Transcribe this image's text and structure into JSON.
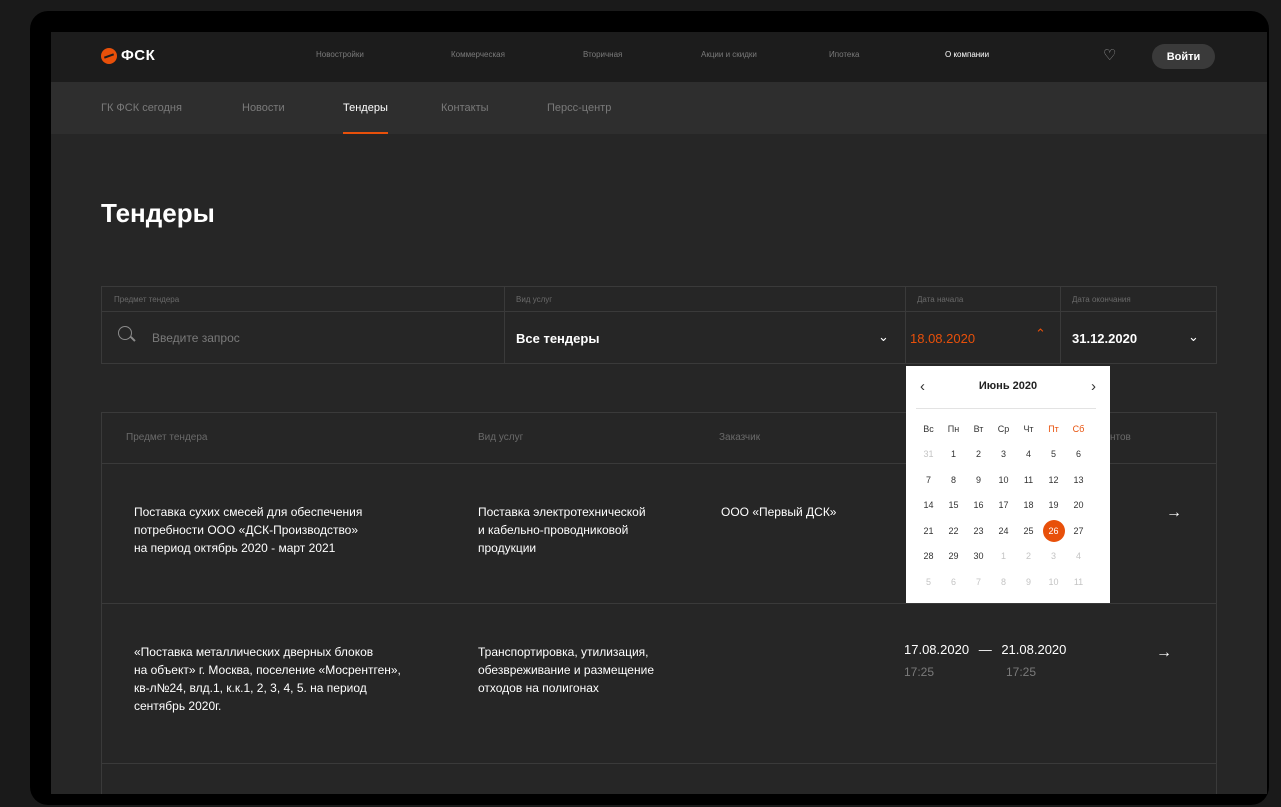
{
  "topnav": {
    "logo_text": "ФСК",
    "items": [
      "Новостройки",
      "Коммерческая",
      "Вторичная",
      "Акции и скидки",
      "Ипотека",
      "О компании"
    ],
    "active_item": "О компании",
    "login_label": "Войти"
  },
  "subnav": {
    "items": [
      "ГК ФСК сегодня",
      "Новости",
      "Тендеры",
      "Контакты",
      "Персс-центр"
    ],
    "active_item": "Тендеры"
  },
  "page_title": "Тендеры",
  "filters": {
    "subject": {
      "label": "Предмет тендера",
      "placeholder": "Введите запрос"
    },
    "service": {
      "label": "Вид услуг",
      "value": "Все тендеры"
    },
    "start": {
      "label": "Дата начала",
      "value": "18.08.2020"
    },
    "end": {
      "label": "Дата окончания",
      "value": "31.12.2020"
    }
  },
  "calendar": {
    "month": "Июнь 2020",
    "weekdays": [
      "Вс",
      "Пн",
      "Вт",
      "Ср",
      "Чт",
      "Пт",
      "Сб"
    ],
    "weekend_days": [
      "Пт",
      "Сб"
    ],
    "days": [
      {
        "d": "31",
        "m": true
      },
      {
        "d": "1"
      },
      {
        "d": "2"
      },
      {
        "d": "3"
      },
      {
        "d": "4"
      },
      {
        "d": "5"
      },
      {
        "d": "6"
      },
      {
        "d": "7"
      },
      {
        "d": "8"
      },
      {
        "d": "9"
      },
      {
        "d": "10"
      },
      {
        "d": "11"
      },
      {
        "d": "12"
      },
      {
        "d": "13"
      },
      {
        "d": "14"
      },
      {
        "d": "15"
      },
      {
        "d": "16"
      },
      {
        "d": "17"
      },
      {
        "d": "18"
      },
      {
        "d": "19"
      },
      {
        "d": "20"
      },
      {
        "d": "21"
      },
      {
        "d": "22"
      },
      {
        "d": "23"
      },
      {
        "d": "24"
      },
      {
        "d": "25"
      },
      {
        "d": "26",
        "s": true
      },
      {
        "d": "27"
      },
      {
        "d": "28"
      },
      {
        "d": "29"
      },
      {
        "d": "30"
      },
      {
        "d": "1",
        "m": true
      },
      {
        "d": "2",
        "m": true
      },
      {
        "d": "3",
        "m": true
      },
      {
        "d": "4",
        "m": true
      },
      {
        "d": "5",
        "m": true
      },
      {
        "d": "6",
        "m": true
      },
      {
        "d": "7",
        "m": true
      },
      {
        "d": "8",
        "m": true
      },
      {
        "d": "9",
        "m": true
      },
      {
        "d": "10",
        "m": true
      },
      {
        "d": "11",
        "m": true
      }
    ],
    "selected_day": "26"
  },
  "table": {
    "headers": [
      "Предмет тендера",
      "Вид услуг",
      "Заказчик",
      "нтов"
    ],
    "rows": [
      {
        "subject": [
          "Поставка сухих смесей для обеспечения",
          "потребности ООО «ДСК-Производство»",
          "на период октябрь 2020 - март 2021"
        ],
        "service": [
          "Поставка электротехнической",
          "и кабельно-проводниковой",
          "продукции"
        ],
        "customer": "ООО «Первый ДСК»",
        "date_from": "",
        "date_to": "",
        "time_from": "",
        "time_to": ""
      },
      {
        "subject": [
          "«Поставка металлических дверных блоков",
          "на объект» г. Москва, поселение «Мосрентген»,",
          "кв-л№24, влд.1, к.к.1, 2, 3, 4, 5. на период",
          "сентябрь 2020г."
        ],
        "service": [
          "Транспортировка, утилизация,",
          "обезвреживание и размещение",
          "отходов на полигонах"
        ],
        "customer": "",
        "date_from": "17.08.2020",
        "date_to": "21.08.2020",
        "time_from": "17:25",
        "time_to": "17:25"
      }
    ],
    "dash": "—"
  },
  "colors": {
    "accent": "#e8500a",
    "background": "#262626",
    "nav": "#1c1c1c",
    "subnav": "#2e2e2e"
  }
}
